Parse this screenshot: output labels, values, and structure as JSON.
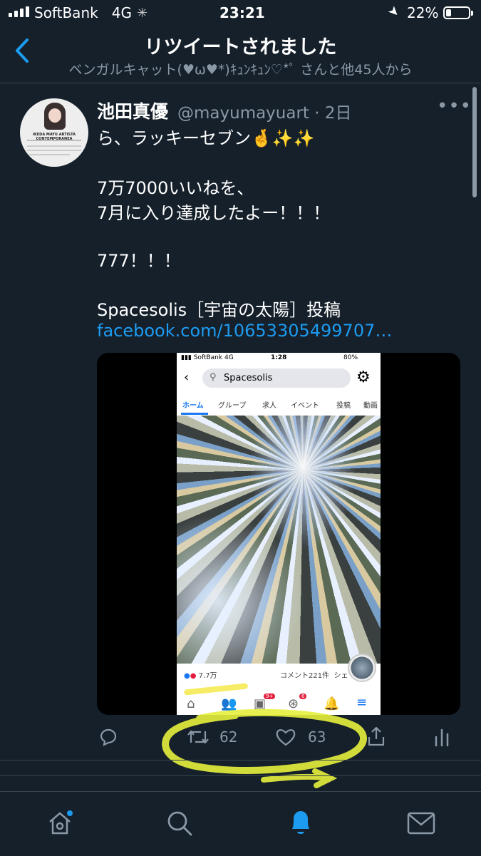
{
  "status_bar": {
    "carrier": "SoftBank",
    "network": "4G",
    "time": "23:21",
    "battery": "22%",
    "battery_level": 0.22
  },
  "header": {
    "title": "リツイートされました",
    "subtitle": "ベンガルキャット(♥ω♥*)ｷｭﾝｷｭﾝ♡*ﾟ さんと他45人から"
  },
  "tweet": {
    "author_name": "池田真優",
    "author_handle": "@mayumayuart · 2日",
    "avatar_caption": "IKEDA MAYU ARTISTA CONTEMPORANEA",
    "lines": [
      "ら、ラッキーセブン🤞✨✨",
      "7万7000いいねを、",
      "7月に入り達成したよー！！！",
      "777！！！",
      "Spacesolis［宇宙の太陽］投稿"
    ],
    "link": "facebook.com/10653305499707…",
    "retweets": "62",
    "likes": "63"
  },
  "media": {
    "status": {
      "carrier": "SoftBank",
      "network": "4G",
      "time": "1:28",
      "battery": "80%"
    },
    "search_text": "Spacesolis",
    "tabs": [
      "ホーム",
      "グループ",
      "求人",
      "イベント",
      "投稿",
      "動画"
    ],
    "reactions": "7.7万",
    "comments": "コメント221件",
    "share": "シェ",
    "badges": [
      "9+",
      "6"
    ]
  },
  "colors": {
    "background": "#15202b",
    "accent": "#1d9bf0",
    "muted": "#8b98a5",
    "highlight": "#e6f03c"
  }
}
